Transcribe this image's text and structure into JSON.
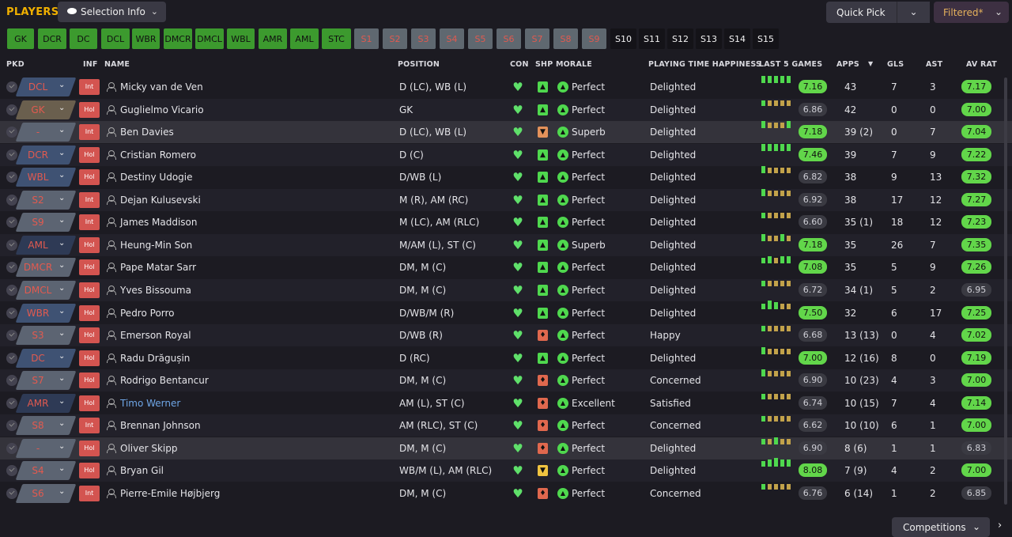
{
  "header": {
    "title": "PLAYERS",
    "selection_info": "Selection Info",
    "quick_pick": "Quick Pick",
    "filtered": "Filtered*"
  },
  "positions": [
    {
      "label": "GK",
      "state": "green"
    },
    {
      "label": "DCR",
      "state": "green"
    },
    {
      "label": "DC",
      "state": "green"
    },
    {
      "label": "DCL",
      "state": "green"
    },
    {
      "label": "WBR",
      "state": "green"
    },
    {
      "label": "DMCR",
      "state": "green"
    },
    {
      "label": "DMCL",
      "state": "green"
    },
    {
      "label": "WBL",
      "state": "green"
    },
    {
      "label": "AMR",
      "state": "green"
    },
    {
      "label": "AML",
      "state": "green"
    },
    {
      "label": "STC",
      "state": "green"
    },
    {
      "label": "S1",
      "state": "grey"
    },
    {
      "label": "S2",
      "state": "grey"
    },
    {
      "label": "S3",
      "state": "grey"
    },
    {
      "label": "S4",
      "state": "grey"
    },
    {
      "label": "S5",
      "state": "grey"
    },
    {
      "label": "S6",
      "state": "grey"
    },
    {
      "label": "S7",
      "state": "grey"
    },
    {
      "label": "S8",
      "state": "grey"
    },
    {
      "label": "S9",
      "state": "grey"
    },
    {
      "label": "S10",
      "state": "black"
    },
    {
      "label": "S11",
      "state": "black"
    },
    {
      "label": "S12",
      "state": "black"
    },
    {
      "label": "S13",
      "state": "black"
    },
    {
      "label": "S14",
      "state": "black"
    },
    {
      "label": "S15",
      "state": "black"
    }
  ],
  "columns": {
    "pkd": "PKD",
    "inf": "INF",
    "name": "NAME",
    "position": "POSITION",
    "con": "CON",
    "shp": "SHP",
    "morale": "MORALE",
    "pth": "PLAYING TIME HAPPINESS",
    "last5": "LAST 5 GAMES",
    "apps": "APPS",
    "gls": "GLS",
    "ast": "AST",
    "avrat": "AV RAT"
  },
  "players": [
    {
      "pkd": "DCL",
      "inf": "Int",
      "name": "Micky van de Ven",
      "position": "D (LC), WB (L)",
      "shp": "green",
      "morale": "Perfect",
      "pth": "Delighted",
      "l5": [
        3,
        3,
        3,
        3,
        3
      ],
      "l5rt": "7.16",
      "l5hi": true,
      "apps": "43",
      "gls": "7",
      "ast": "3",
      "av": "7.17",
      "avhi": true
    },
    {
      "pkd": "GK",
      "inf": "Hol",
      "name": "Guglielmo Vicario",
      "position": "GK",
      "shp": "green",
      "morale": "Perfect",
      "pth": "Delighted",
      "l5": [
        2,
        2,
        2,
        2,
        2
      ],
      "l5rt": "6.86",
      "l5hi": false,
      "apps": "42",
      "gls": "0",
      "ast": "0",
      "av": "7.00",
      "avhi": true
    },
    {
      "pkd": "-",
      "inf": "Int",
      "name": "Ben Davies",
      "position": "D (LC), WB (L)",
      "shp": "orange",
      "morale": "Superb",
      "pth": "Delighted",
      "l5": [
        3,
        2,
        2,
        2,
        3
      ],
      "l5rt": "7.18",
      "l5hi": true,
      "apps": "39 (2)",
      "gls": "0",
      "ast": "7",
      "av": "7.04",
      "avhi": true
    },
    {
      "pkd": "DCR",
      "inf": "Hol",
      "name": "Cristian Romero",
      "position": "D (C)",
      "shp": "green",
      "morale": "Perfect",
      "pth": "Delighted",
      "l5": [
        3,
        3,
        3,
        3,
        3
      ],
      "l5rt": "7.46",
      "l5hi": true,
      "apps": "39",
      "gls": "7",
      "ast": "9",
      "av": "7.22",
      "avhi": true
    },
    {
      "pkd": "WBL",
      "inf": "Hol",
      "name": "Destiny Udogie",
      "position": "D/WB (L)",
      "shp": "green",
      "morale": "Perfect",
      "pth": "Delighted",
      "l5": [
        3,
        2,
        2,
        2,
        2
      ],
      "l5rt": "6.82",
      "l5hi": false,
      "apps": "38",
      "gls": "9",
      "ast": "13",
      "av": "7.32",
      "avhi": true
    },
    {
      "pkd": "S2",
      "inf": "Int",
      "name": "Dejan Kulusevski",
      "position": "M (R), AM (RC)",
      "shp": "green",
      "morale": "Perfect",
      "pth": "Delighted",
      "l5": [
        3,
        2,
        2,
        2,
        2
      ],
      "l5rt": "6.92",
      "l5hi": false,
      "apps": "38",
      "gls": "17",
      "ast": "12",
      "av": "7.27",
      "avhi": true
    },
    {
      "pkd": "S9",
      "inf": "Int",
      "name": "James Maddison",
      "position": "M (LC), AM (RLC)",
      "shp": "green",
      "morale": "Perfect",
      "pth": "Delighted",
      "l5": [
        2,
        2,
        2,
        2,
        2
      ],
      "l5rt": "6.60",
      "l5hi": false,
      "apps": "35 (1)",
      "gls": "18",
      "ast": "12",
      "av": "7.23",
      "avhi": true
    },
    {
      "pkd": "AML",
      "inf": "Hol",
      "name": "Heung-Min Son",
      "position": "M/AM (L), ST (C)",
      "shp": "green",
      "morale": "Superb",
      "pth": "Delighted",
      "l5": [
        3,
        2,
        2,
        3,
        2
      ],
      "l5rt": "7.18",
      "l5hi": true,
      "apps": "35",
      "gls": "26",
      "ast": "7",
      "av": "7.35",
      "avhi": true
    },
    {
      "pkd": "DMCR",
      "inf": "Hol",
      "name": "Pape Matar Sarr",
      "position": "DM, M (C)",
      "shp": "green",
      "morale": "Perfect",
      "pth": "Delighted",
      "l5": [
        2,
        3,
        2,
        3,
        3
      ],
      "l5rt": "7.08",
      "l5hi": true,
      "apps": "35",
      "gls": "5",
      "ast": "9",
      "av": "7.26",
      "avhi": true
    },
    {
      "pkd": "DMCL",
      "inf": "Hol",
      "name": "Yves Bissouma",
      "position": "DM, M (C)",
      "shp": "green",
      "morale": "Perfect",
      "pth": "Delighted",
      "l5": [
        2,
        2,
        2,
        2,
        2
      ],
      "l5rt": "6.72",
      "l5hi": false,
      "apps": "34 (1)",
      "gls": "5",
      "ast": "2",
      "av": "6.95",
      "avhi": false
    },
    {
      "pkd": "WBR",
      "inf": "Hol",
      "name": "Pedro Porro",
      "position": "D/WB/M (R)",
      "shp": "green",
      "morale": "Perfect",
      "pth": "Delighted",
      "l5": [
        2,
        4,
        3,
        2,
        2
      ],
      "l5rt": "7.50",
      "l5hi": true,
      "apps": "32",
      "gls": "6",
      "ast": "17",
      "av": "7.25",
      "avhi": true
    },
    {
      "pkd": "S3",
      "inf": "Hol",
      "name": "Emerson Royal",
      "position": "D/WB (R)",
      "shp": "red",
      "morale": "Perfect",
      "pth": "Happy",
      "l5": [
        2,
        2,
        2,
        2,
        2
      ],
      "l5rt": "6.68",
      "l5hi": false,
      "apps": "13 (13)",
      "gls": "0",
      "ast": "4",
      "av": "7.02",
      "avhi": true
    },
    {
      "pkd": "DC",
      "inf": "Hol",
      "name": "Radu Drăgușin",
      "position": "D (RC)",
      "shp": "green",
      "morale": "Perfect",
      "pth": "Delighted",
      "l5": [
        3,
        2,
        2,
        2,
        2
      ],
      "l5rt": "7.00",
      "l5hi": true,
      "apps": "12 (16)",
      "gls": "8",
      "ast": "0",
      "av": "7.19",
      "avhi": true
    },
    {
      "pkd": "S7",
      "inf": "Hol",
      "name": "Rodrigo Bentancur",
      "position": "DM, M (C)",
      "shp": "red",
      "morale": "Perfect",
      "pth": "Concerned",
      "l5": [
        3,
        2,
        2,
        2,
        2
      ],
      "l5rt": "6.90",
      "l5hi": false,
      "apps": "10 (23)",
      "gls": "4",
      "ast": "3",
      "av": "7.00",
      "avhi": true
    },
    {
      "pkd": "AMR",
      "inf": "Hol",
      "name": "Timo Werner",
      "position": "AM (L), ST (C)",
      "shp": "red",
      "morale": "Excellent",
      "pth": "Satisfied",
      "l5": [
        2,
        2,
        2,
        2,
        2
      ],
      "l5rt": "6.74",
      "l5hi": false,
      "apps": "10 (15)",
      "gls": "7",
      "ast": "4",
      "av": "7.14",
      "avhi": true,
      "link": true
    },
    {
      "pkd": "S8",
      "inf": "Int",
      "name": "Brennan Johnson",
      "position": "AM (RLC), ST (C)",
      "shp": "red",
      "morale": "Perfect",
      "pth": "Concerned",
      "l5": [
        2,
        2,
        2,
        2,
        2
      ],
      "l5rt": "6.62",
      "l5hi": false,
      "apps": "10 (10)",
      "gls": "6",
      "ast": "1",
      "av": "7.00",
      "avhi": true
    },
    {
      "pkd": "-",
      "inf": "Hol",
      "name": "Oliver Skipp",
      "position": "DM, M (C)",
      "shp": "red",
      "morale": "Perfect",
      "pth": "Delighted",
      "l5": [
        2,
        2,
        3,
        2,
        2
      ],
      "l5rt": "6.90",
      "l5hi": false,
      "apps": "8 (6)",
      "gls": "1",
      "ast": "1",
      "av": "6.83",
      "avhi": false
    },
    {
      "pkd": "S4",
      "inf": "Hol",
      "name": "Bryan Gil",
      "position": "WB/M (L), AM (RLC)",
      "shp": "yellow",
      "morale": "Perfect",
      "pth": "Delighted",
      "l5": [
        2,
        3,
        4,
        3,
        3
      ],
      "l5rt": "8.08",
      "l5hi": true,
      "apps": "7 (9)",
      "gls": "4",
      "ast": "2",
      "av": "7.00",
      "avhi": true
    },
    {
      "pkd": "S6",
      "inf": "Int",
      "name": "Pierre-Emile Højbjerg",
      "position": "DM, M (C)",
      "shp": "red",
      "morale": "Perfect",
      "pth": "Concerned",
      "l5": [
        2,
        2,
        2,
        2,
        2
      ],
      "l5rt": "6.76",
      "l5hi": false,
      "apps": "6 (14)",
      "gls": "1",
      "ast": "2",
      "av": "6.85",
      "avhi": false
    }
  ],
  "footer": {
    "competitions": "Competitions"
  }
}
